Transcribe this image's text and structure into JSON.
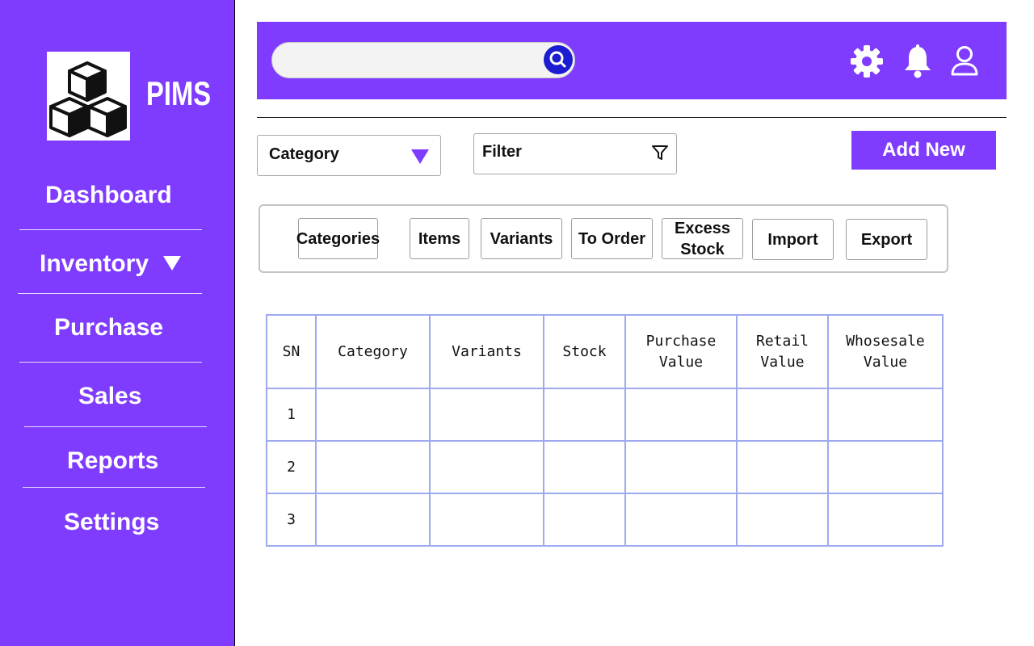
{
  "app": {
    "brand": "PIMS"
  },
  "sidebar": {
    "items": [
      {
        "label": "Dashboard"
      },
      {
        "label": "Inventory"
      },
      {
        "label": "Purchase"
      },
      {
        "label": "Sales"
      },
      {
        "label": "Reports"
      },
      {
        "label": "Settings"
      }
    ]
  },
  "header": {
    "search": {
      "placeholder": "",
      "value": ""
    },
    "icons": [
      "search-icon",
      "gear-icon",
      "bell-icon",
      "user-icon"
    ]
  },
  "toolbar": {
    "category_select": {
      "selected": "Category"
    },
    "filter": {
      "label": "Filter"
    },
    "add_button": "Add New"
  },
  "tabs": [
    {
      "label": "Categories"
    },
    {
      "label": "Items"
    },
    {
      "label": "Variants"
    },
    {
      "label": "To Order"
    },
    {
      "label": "Excess\nStock"
    },
    {
      "label": "Import"
    },
    {
      "label": "Export"
    }
  ],
  "table": {
    "columns": [
      "SN",
      "Category",
      "Variants",
      "Stock",
      "Purchase\nValue",
      "Retail\nValue",
      "Whosesale\nValue"
    ],
    "rows": [
      [
        "1",
        "",
        "",
        "",
        "",
        "",
        ""
      ],
      [
        "2",
        "",
        "",
        "",
        "",
        "",
        ""
      ],
      [
        "3",
        "",
        "",
        "",
        "",
        "",
        ""
      ]
    ]
  },
  "colors": {
    "accent": "#7f3cff",
    "search_button": "#1c1cd0",
    "table_border": "#9eaaf0"
  }
}
